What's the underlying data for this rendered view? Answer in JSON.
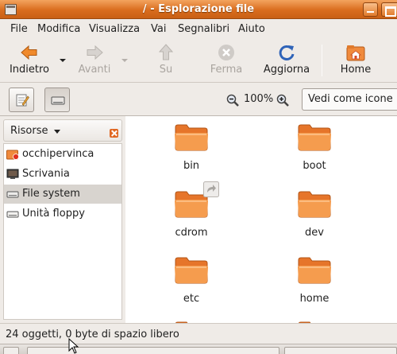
{
  "window": {
    "title": "/ - Esplorazione file"
  },
  "menubar": [
    "File",
    "Modifica",
    "Visualizza",
    "Vai",
    "Segnalibri",
    "Aiuto"
  ],
  "toolbar": {
    "back_label": "Indietro",
    "forward_label": "Avanti",
    "up_label": "Su",
    "stop_label": "Ferma",
    "reload_label": "Aggiorna",
    "home_label": "Home"
  },
  "locationbar": {
    "zoom_level": "100%",
    "view_mode": "Vedi come icone"
  },
  "sidebar": {
    "title": "Risorse",
    "items": [
      {
        "label": "occhipervinca",
        "icon": "home-folder-icon"
      },
      {
        "label": "Scrivania",
        "icon": "desktop-icon"
      },
      {
        "label": "File system",
        "icon": "harddisk-icon",
        "selected": true
      },
      {
        "label": "Unità floppy",
        "icon": "floppy-icon"
      }
    ]
  },
  "files": [
    {
      "name": "bin"
    },
    {
      "name": "boot"
    },
    {
      "name": "cdrom",
      "symlink": true
    },
    {
      "name": "dev"
    },
    {
      "name": "etc"
    },
    {
      "name": "home"
    }
  ],
  "statusbar": {
    "text": "24 oggetti, 0 byte di spazio libero"
  },
  "colors": {
    "accent": "#e0772c",
    "titlebar": "#d96d1e",
    "folder": "#f08a3c"
  }
}
